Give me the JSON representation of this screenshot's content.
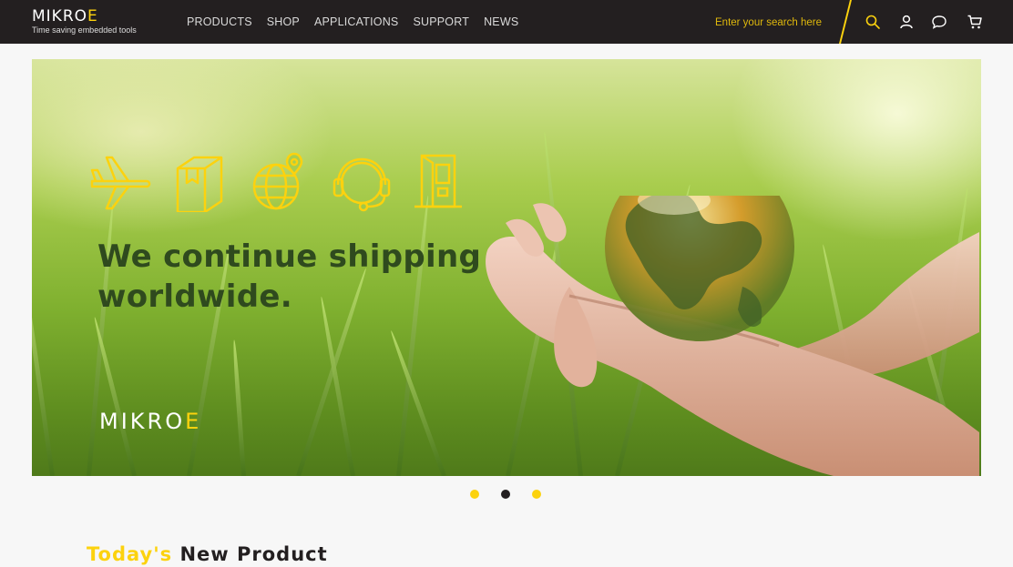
{
  "header": {
    "logo_text": "MIKROE",
    "tagline": "Time saving embedded tools",
    "nav": [
      "PRODUCTS",
      "SHOP",
      "APPLICATIONS",
      "SUPPORT",
      "NEWS"
    ],
    "search_placeholder": "Enter your search here",
    "icons": [
      "search-icon",
      "user-icon",
      "chat-icon",
      "cart-icon"
    ]
  },
  "hero": {
    "title_line1": "We continue shipping",
    "title_line2": "worldwide.",
    "logo_text": "MIKROE",
    "icons": [
      "airplane-icon",
      "package-icon",
      "globe-pin-icon",
      "support-headset-icon",
      "door-icon"
    ]
  },
  "carousel": {
    "slides": 3,
    "active_index": 1
  },
  "section": {
    "title_highlight": "Today's",
    "title_rest": "New Product"
  },
  "colors": {
    "brand_yellow": "#fcd20e",
    "header_bg": "#231f20",
    "page_bg": "#f7f7f7"
  }
}
